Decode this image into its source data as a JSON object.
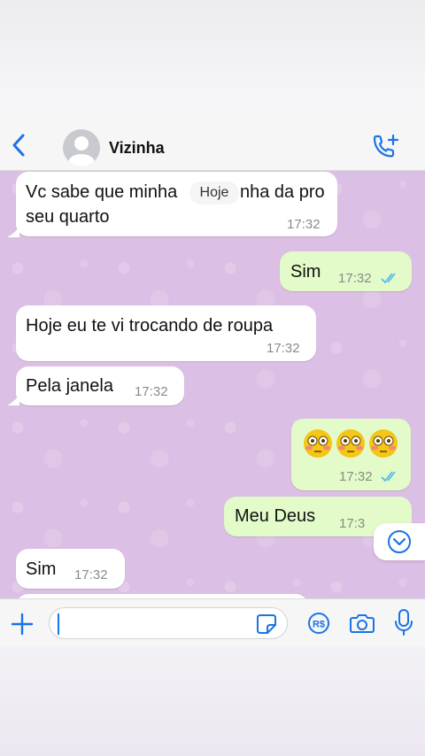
{
  "header": {
    "back_icon": "chevron-left-icon",
    "contact_name": "Vizinha",
    "call_icon": "phone-add-icon"
  },
  "chat": {
    "date_pill": "Hoje",
    "messages": [
      {
        "direction": "in",
        "line1": "Vc sabe que minha",
        "line1b": "nha da pro",
        "line2": "seu quarto",
        "time": "17:32"
      },
      {
        "direction": "out",
        "text": "Sim",
        "time": "17:32",
        "read": true
      },
      {
        "direction": "in",
        "text": "Hoje eu te vi trocando de roupa",
        "time": "17:32"
      },
      {
        "direction": "in",
        "text": "Pela janela",
        "time": "17:32"
      },
      {
        "direction": "out",
        "text": "😳😳😳",
        "time": "17:32",
        "read": true
      },
      {
        "direction": "out",
        "text": "Meu Deus",
        "time": "17:3"
      },
      {
        "direction": "in",
        "text": "Sim",
        "time": "17:32"
      }
    ],
    "scroll_button_icon": "chevron-down-circle-icon"
  },
  "input_bar": {
    "plus_icon": "plus-icon",
    "message_value": "",
    "sticker_icon": "sticker-icon",
    "pay_icon": "pix-payment-icon",
    "camera_icon": "camera-icon",
    "mic_icon": "microphone-icon"
  },
  "colors": {
    "accent": "#1a73e8",
    "chat_background": "#dcbfe4",
    "outgoing_bubble": "#e2fbc9",
    "incoming_bubble": "#ffffff",
    "read_ticks": "#53bdeb"
  }
}
